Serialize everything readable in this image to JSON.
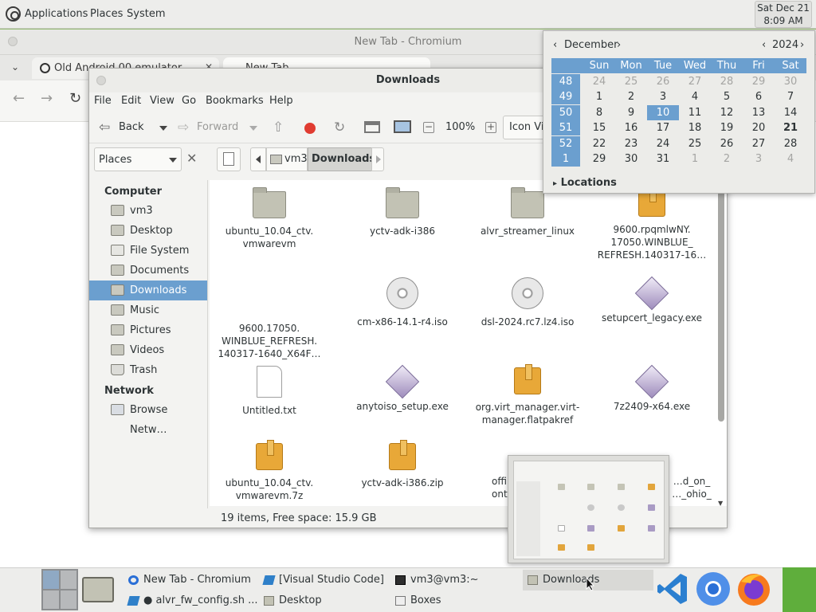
{
  "top_panel": {
    "menus": [
      "Applications",
      "Places",
      "System"
    ],
    "clock": {
      "day": "Sat Dec 21",
      "time": "8:09 AM"
    }
  },
  "chromium": {
    "title": "New Tab - Chromium",
    "tabs": [
      {
        "label": "Old Android 00 emulator",
        "close": "✕"
      },
      {
        "label": "New Tab",
        "close": ""
      }
    ]
  },
  "file_manager": {
    "title": "Downloads",
    "menus": [
      "File",
      "Edit",
      "View",
      "Go",
      "Bookmarks",
      "Help"
    ],
    "toolbar": {
      "back": "Back",
      "forward": "Forward",
      "zoom": "100%",
      "view_mode": "Icon View"
    },
    "places_combo": "Places",
    "path": [
      "vm3",
      "Downloads"
    ],
    "sidebar": {
      "computer_heading": "Computer",
      "computer_items": [
        {
          "label": "vm3",
          "icon": "home-icon"
        },
        {
          "label": "Desktop",
          "icon": "desktop-icon"
        },
        {
          "label": "File System",
          "icon": "drive-icon"
        },
        {
          "label": "Documents",
          "icon": "folder-icon"
        },
        {
          "label": "Downloads",
          "icon": "downloads-icon",
          "selected": true
        },
        {
          "label": "Music",
          "icon": "music-icon"
        },
        {
          "label": "Pictures",
          "icon": "pictures-icon"
        },
        {
          "label": "Videos",
          "icon": "videos-icon"
        },
        {
          "label": "Trash",
          "icon": "trash-icon"
        }
      ],
      "network_heading": "Network",
      "network_items": [
        {
          "label": "Browse Netw…",
          "icon": "network-icon"
        }
      ]
    },
    "files": [
      {
        "name": "ubuntu_10.04_ctv.\nvmwarevm",
        "type": "folder"
      },
      {
        "name": "yctv-adk-i386",
        "type": "folder"
      },
      {
        "name": "alvr_streamer_linux",
        "type": "folder"
      },
      {
        "name": "9600.rpqmlwNY.\n17050.WINBLUE_\nREFRESH.140317-16…",
        "type": "package"
      },
      {
        "name": "9600.17050.\nWINBLUE_REFRESH.\n140317-1640_X64F…",
        "type": "blank"
      },
      {
        "name": "cm-x86-14.1-r4.iso",
        "type": "disc"
      },
      {
        "name": "dsl-2024.rc7.lz4.iso",
        "type": "disc"
      },
      {
        "name": "setupcert_legacy.exe",
        "type": "exe"
      },
      {
        "name": "Untitled.txt",
        "type": "txt"
      },
      {
        "name": "anytoiso_setup.exe",
        "type": "exe"
      },
      {
        "name": "org.virt_manager.virt-\nmanager.flatpakref",
        "type": "package"
      },
      {
        "name": "7z2409-x64.exe",
        "type": "exe"
      },
      {
        "name": "ubuntu_10.04_ctv.\nvmwarevm.7z",
        "type": "package"
      },
      {
        "name": "yctv-adk-i386.zip",
        "type": "package"
      },
      {
        "name": "offi…\nontikto…",
        "type": "blank"
      },
      {
        "name": "…d_on_\n…_ohio_",
        "type": "blank"
      }
    ],
    "status": "19 items, Free space: 15.9 GB",
    "scroll_fraction_visible": 0.72
  },
  "calendar": {
    "month": "December",
    "year": "2024",
    "weekdays": [
      "Sun",
      "Mon",
      "Tue",
      "Wed",
      "Thu",
      "Fri",
      "Sat"
    ],
    "weeks": [
      {
        "num": "48",
        "days": [
          [
            "24",
            "o"
          ],
          [
            "25",
            "o"
          ],
          [
            "26",
            "o"
          ],
          [
            "27",
            "o"
          ],
          [
            "28",
            "o"
          ],
          [
            "29",
            "o"
          ],
          [
            "30",
            "o"
          ]
        ]
      },
      {
        "num": "49",
        "days": [
          [
            "1",
            ""
          ],
          [
            "2",
            ""
          ],
          [
            "3",
            ""
          ],
          [
            "4",
            ""
          ],
          [
            "5",
            ""
          ],
          [
            "6",
            ""
          ],
          [
            "7",
            ""
          ]
        ]
      },
      {
        "num": "50",
        "days": [
          [
            "8",
            ""
          ],
          [
            "9",
            ""
          ],
          [
            "10",
            "s"
          ],
          [
            "11",
            ""
          ],
          [
            "12",
            ""
          ],
          [
            "13",
            ""
          ],
          [
            "14",
            ""
          ]
        ]
      },
      {
        "num": "51",
        "days": [
          [
            "15",
            ""
          ],
          [
            "16",
            ""
          ],
          [
            "17",
            ""
          ],
          [
            "18",
            ""
          ],
          [
            "19",
            ""
          ],
          [
            "20",
            ""
          ],
          [
            "21",
            "t"
          ]
        ]
      },
      {
        "num": "52",
        "days": [
          [
            "22",
            ""
          ],
          [
            "23",
            ""
          ],
          [
            "24",
            ""
          ],
          [
            "25",
            ""
          ],
          [
            "26",
            ""
          ],
          [
            "27",
            ""
          ],
          [
            "28",
            ""
          ]
        ]
      },
      {
        "num": "1",
        "days": [
          [
            "29",
            ""
          ],
          [
            "30",
            ""
          ],
          [
            "31",
            ""
          ],
          [
            "1",
            "o"
          ],
          [
            "2",
            "o"
          ],
          [
            "3",
            "o"
          ],
          [
            "4",
            "o"
          ]
        ]
      }
    ],
    "locations_label": "Locations"
  },
  "taskbar": {
    "tasks": [
      {
        "label": "New Tab - Chromium",
        "icon": "chromium-icon"
      },
      {
        "label": "[Visual Studio Code]",
        "icon": "vscode-icon"
      },
      {
        "label": "vm3@vm3:~",
        "icon": "terminal-icon"
      },
      {
        "label": "Downloads",
        "icon": "folder-icon",
        "active": true
      },
      {
        "label": "● alvr_fw_config.sh ...",
        "icon": "vscode-icon"
      },
      {
        "label": "Desktop",
        "icon": "desktop-icon"
      },
      {
        "label": "Boxes",
        "icon": "boxes-icon"
      }
    ],
    "launchers": [
      "vscode-icon",
      "chromium-icon",
      "firefox-icon"
    ]
  },
  "colors": {
    "selection": "#6b9fcf",
    "panel": "#ededeb",
    "desktop": "#8fb76a"
  }
}
